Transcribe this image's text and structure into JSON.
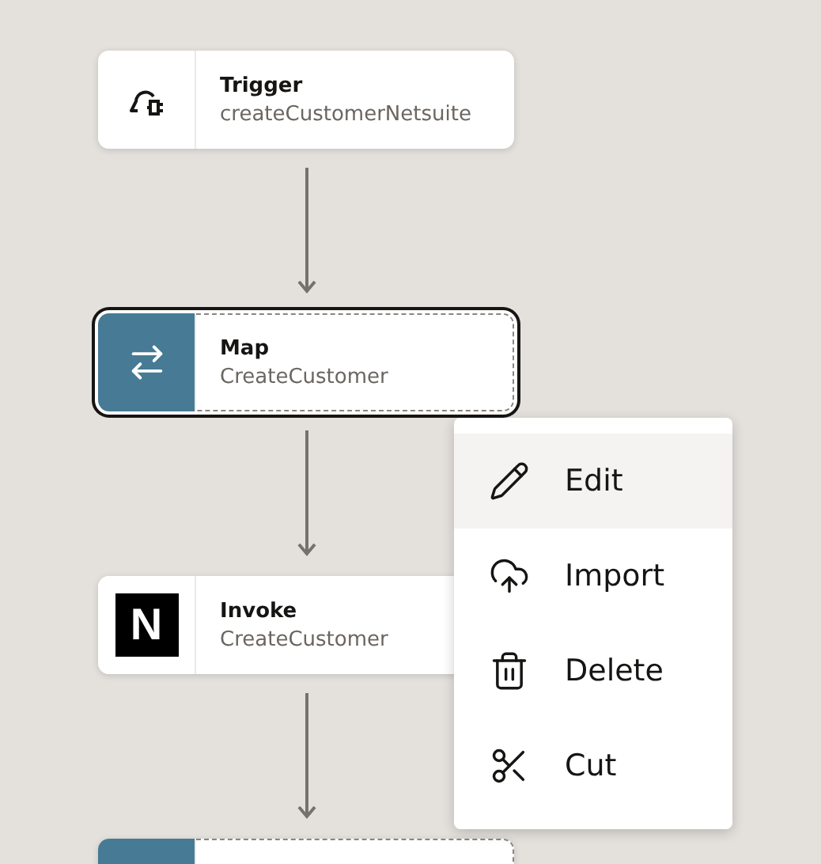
{
  "flow": [
    {
      "kind": "trigger",
      "title": "Trigger",
      "subtitle": "createCustomerNetsuite",
      "selected": false
    },
    {
      "kind": "map",
      "title": "Map",
      "subtitle": "CreateCustomer",
      "selected": true
    },
    {
      "kind": "invoke",
      "logo_text": "N",
      "title": "Invoke",
      "subtitle": "CreateCustomer",
      "selected": false
    },
    {
      "kind": "map",
      "selected": false
    }
  ],
  "context_menu": [
    {
      "kind": "edit",
      "label": "Edit",
      "highlighted": true
    },
    {
      "kind": "import",
      "label": "Import",
      "highlighted": false
    },
    {
      "kind": "delete",
      "label": "Delete",
      "highlighted": false
    },
    {
      "kind": "cut",
      "label": "Cut",
      "highlighted": false
    }
  ]
}
